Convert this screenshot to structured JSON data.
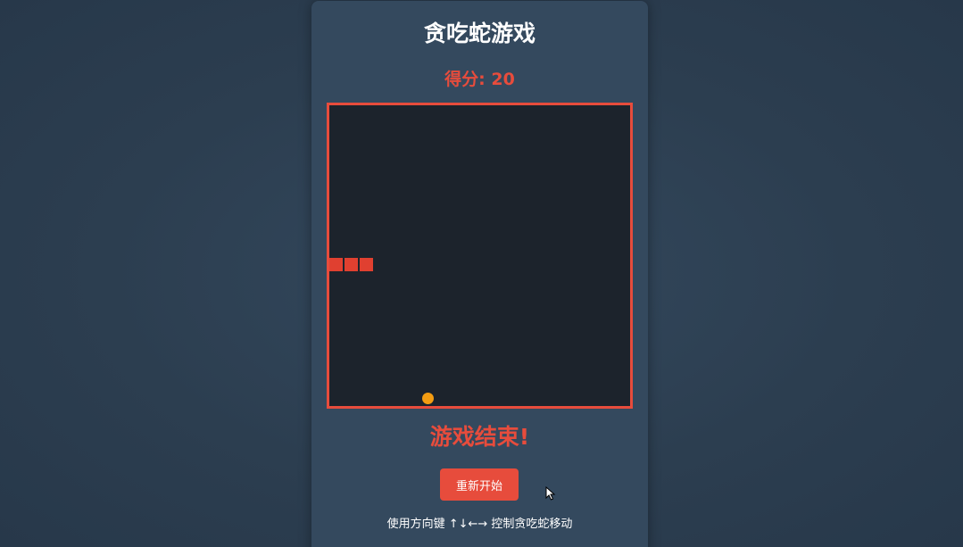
{
  "game": {
    "title": "贪吃蛇游戏",
    "score_text": "得分: 20",
    "game_over_text": "游戏结束!",
    "restart_label": "重新开始",
    "instructions": "使用方向键 ↑↓←→ 控制贪吃蛇移动"
  },
  "board": {
    "snake_segments": 3,
    "snake_color": "#e04030",
    "food_color": "#f39c12",
    "border_color": "#e74c3c",
    "background_color": "#1c232c"
  },
  "colors": {
    "page_background": "#2c3e50",
    "panel_background": "#34495e",
    "accent": "#e74c3c"
  },
  "icons": {
    "cursor": "mouse-pointer-icon"
  }
}
